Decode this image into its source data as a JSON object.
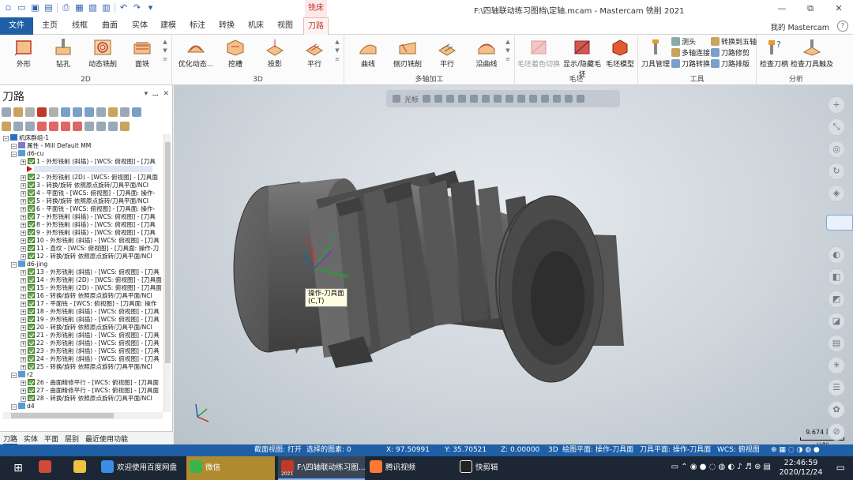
{
  "title_bar": {
    "context_tab": "铣床",
    "window_title": "F:\\四轴联动练习图档\\定轴.mcam - Mastercam 铣削 2021",
    "min": "—",
    "restore": "⧉",
    "close": "✕"
  },
  "ribbon_tabs": [
    "文件",
    "主页",
    "线框",
    "曲面",
    "实体",
    "建模",
    "标注",
    "转换",
    "机床",
    "视图",
    "刀路"
  ],
  "my_mastercam": "我的 Mastercam",
  "ribbon": {
    "g2d": {
      "label": "2D",
      "buttons": [
        "外形",
        "钻孔",
        "动态铣削",
        "面铣"
      ]
    },
    "g3d": {
      "label": "3D",
      "buttons": [
        "优化动态...",
        "挖槽",
        "投影",
        "平行"
      ]
    },
    "gmulti": {
      "label": "多轴加工",
      "buttons": [
        "曲线",
        "侧刃铣削",
        "平行",
        "沿曲线"
      ]
    },
    "gstock": {
      "label": "毛坯",
      "buttons": [
        "毛坯着色切换",
        "显示/隐藏毛坯",
        "毛坯模型"
      ]
    },
    "gtools": {
      "label": "工具",
      "big": "刀具管理",
      "small": [
        "测头",
        "多轴连接",
        "刀路转换",
        "转换到五轴",
        "刀路修剪",
        "刀路排版"
      ]
    },
    "ganalysis": {
      "label": "分析",
      "buttons": [
        "检查刀柄",
        "检查刀具触及"
      ]
    }
  },
  "left_panel": {
    "title": "刀路",
    "ctrl_pin": "▾",
    "ctrl_dock": "ꟷ",
    "ctrl_close": "✕",
    "tree": [
      {
        "type": "root",
        "text": "机床群组-1"
      },
      {
        "type": "prop",
        "text": "属性 - Mill Default MM"
      },
      {
        "type": "group",
        "text": "d6-cu"
      },
      {
        "type": "op",
        "text": "1 - 外形铣削 (斜插) - [WCS: 俯视图] - [刀具"
      },
      {
        "type": "insert",
        "text": ""
      },
      {
        "type": "op",
        "text": "2 - 外形铣削 (2D) - [WCS: 俯视图] - [刀具面"
      },
      {
        "type": "op",
        "text": "3 - 转换/旋转 依照原点旋转/刀具平面/NCI"
      },
      {
        "type": "op",
        "text": "4 - 平面铣 - [WCS: 俯视图] - [刀具面: 操作-"
      },
      {
        "type": "op",
        "text": "5 - 转换/旋转 依照原点旋转/刀具平面/NCI"
      },
      {
        "type": "op",
        "text": "6 - 平面铣 - [WCS: 俯视图] - [刀具面: 操作-"
      },
      {
        "type": "op",
        "text": "7 - 外形铣削 (斜插) - [WCS: 俯视图] - [刀具"
      },
      {
        "type": "op",
        "text": "8 - 外形铣削 (斜插) - [WCS: 俯视图] - [刀具"
      },
      {
        "type": "op",
        "text": "9 - 外形铣削 (斜插) - [WCS: 俯视图] - [刀具"
      },
      {
        "type": "op",
        "text": "10 - 外形铣削 (斜插) - [WCS: 俯视图] - [刀具"
      },
      {
        "type": "op",
        "text": "11 - 直纹 - [WCS: 俯视图] - [刀具面: 操作-刀"
      },
      {
        "type": "op",
        "text": "12 - 转换/旋转 依照原点旋转/刀具平面/NCI"
      },
      {
        "type": "group",
        "text": "d6-jing"
      },
      {
        "type": "op",
        "text": "13 - 外形铣削 (斜插) - [WCS: 俯视图] - [刀具"
      },
      {
        "type": "op",
        "text": "14 - 外形铣削 (2D) - [WCS: 俯视图] - [刀具面"
      },
      {
        "type": "op",
        "text": "15 - 外形铣削 (2D) - [WCS: 俯视图] - [刀具面"
      },
      {
        "type": "op",
        "text": "16 - 转换/旋转 依照原点旋转/刀具平面/NCI"
      },
      {
        "type": "op",
        "text": "17 - 平面铣 - [WCS: 俯视图] - [刀具面: 操作"
      },
      {
        "type": "op",
        "text": "18 - 外形铣削 (斜插) - [WCS: 俯视图] - [刀具"
      },
      {
        "type": "op",
        "text": "19 - 外形铣削 (斜插) - [WCS: 俯视图] - [刀具"
      },
      {
        "type": "op",
        "text": "20 - 转换/旋转 依照原点旋转/刀具平面/NCI"
      },
      {
        "type": "op",
        "text": "21 - 外形铣削 (斜插) - [WCS: 俯视图] - [刀具"
      },
      {
        "type": "op",
        "text": "22 - 外形铣削 (斜插) - [WCS: 俯视图] - [刀具"
      },
      {
        "type": "op",
        "text": "23 - 外形铣削 (斜插) - [WCS: 俯视图] - [刀具"
      },
      {
        "type": "op",
        "text": "24 - 外形铣削 (斜插) - [WCS: 俯视图] - [刀具"
      },
      {
        "type": "op",
        "text": "25 - 转换/旋转 依照原点旋转/刀具平面/NCI"
      },
      {
        "type": "group",
        "text": "r2"
      },
      {
        "type": "op",
        "text": "26 - 曲面精修平行 - [WCS: 俯视图] - [刀具面"
      },
      {
        "type": "op",
        "text": "27 - 曲面精修平行 - [WCS: 俯视图] - [刀具面"
      },
      {
        "type": "op",
        "text": "28 - 转换/旋转 依照原点旋转/刀具平面/NCI"
      },
      {
        "type": "group",
        "text": "d4"
      }
    ]
  },
  "bottom_tabs": [
    "刀路",
    "实体",
    "平面",
    "层别",
    "最近使用功能"
  ],
  "viewport": {
    "toolbar_label": "光标",
    "tooltip_line1": "操作-刀具面",
    "tooltip_line2": "(C,T)",
    "axis_x": "X",
    "axis_y": "Y",
    "axis_z": "Z",
    "scale_value": "9.674 毫米",
    "scale_unit": "公制"
  },
  "status_bar": {
    "section_view": "截面视图: 打开",
    "selected": "选择的图素: 0",
    "x": "X:   97.50991",
    "y": "Y:   35.70521",
    "z": "Z:   0.00000",
    "mode": "3D",
    "draw_plane": "绘图平面: 操作-刀具面",
    "tool_plane": "刀具平面: 操作-刀具面",
    "wcs": "WCS: 俯视图"
  },
  "taskbar": {
    "items": [
      "欢迎使用百度网盘",
      "微信",
      "F:\\四轴联动练习图...",
      "腾讯视频",
      "快剪辑"
    ],
    "mc_badge": "2021",
    "time": "22:46:59",
    "date": "2020/12/24"
  },
  "colors": {
    "accent": "#1f5fa6",
    "context_red": "#c0392b",
    "part_gray": "#5a5a5a",
    "check_green": "#6aa84f"
  }
}
